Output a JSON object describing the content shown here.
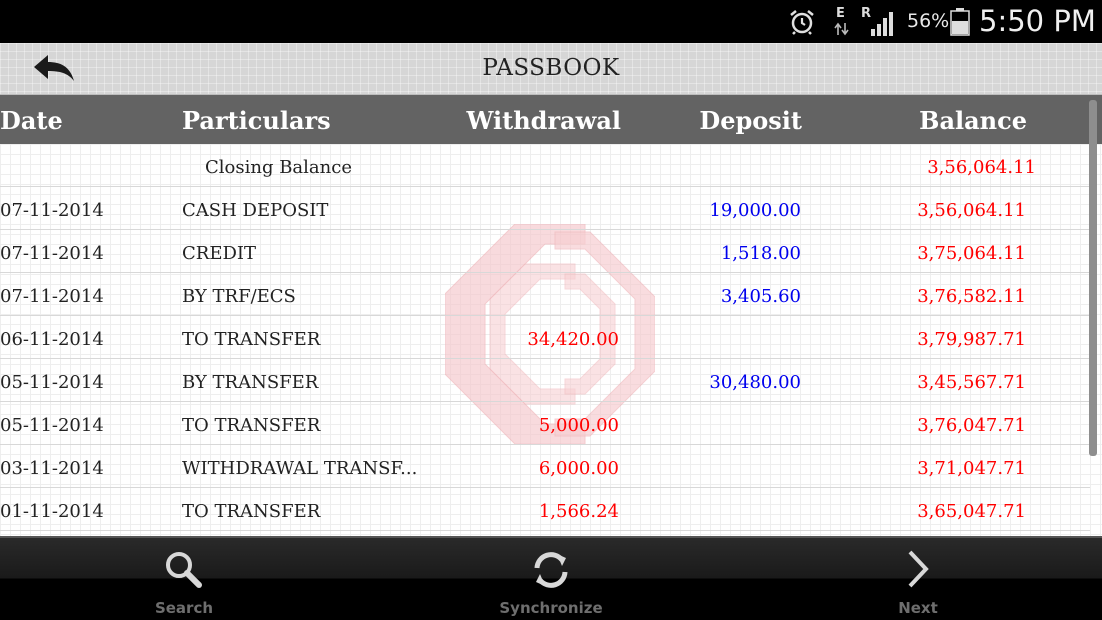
{
  "status_bar": {
    "network_letters": [
      "E",
      "R"
    ],
    "battery_percent": "56%",
    "time": "5:50 PM",
    "icons": [
      "alarm-icon",
      "data-arrows-icon",
      "signal-icon",
      "battery-icon"
    ]
  },
  "header": {
    "title": "PASSBOOK",
    "back_icon": "back-arrow-icon"
  },
  "table": {
    "columns": [
      "Date",
      "Particulars",
      "Withdrawal",
      "Deposit",
      "Balance"
    ],
    "closing": {
      "label": "Closing Balance",
      "balance": "3,56,064.11"
    },
    "rows": [
      {
        "date": "07-11-2014",
        "particulars": "CASH DEPOSIT",
        "withdrawal": "",
        "deposit": "19,000.00",
        "balance": "3,56,064.11"
      },
      {
        "date": "07-11-2014",
        "particulars": "CREDIT",
        "withdrawal": "",
        "deposit": "1,518.00",
        "balance": "3,75,064.11"
      },
      {
        "date": "07-11-2014",
        "particulars": "BY TRF/ECS",
        "withdrawal": "",
        "deposit": "3,405.60",
        "balance": "3,76,582.11"
      },
      {
        "date": "06-11-2014",
        "particulars": "TO TRANSFER",
        "withdrawal": "34,420.00",
        "deposit": "",
        "balance": "3,79,987.71"
      },
      {
        "date": "05-11-2014",
        "particulars": "BY TRANSFER",
        "withdrawal": "",
        "deposit": "30,480.00",
        "balance": "3,45,567.71"
      },
      {
        "date": "05-11-2014",
        "particulars": "TO TRANSFER",
        "withdrawal": "5,000.00",
        "deposit": "",
        "balance": "3,76,047.71"
      },
      {
        "date": "03-11-2014",
        "particulars": "WITHDRAWAL TRANSF...",
        "withdrawal": "6,000.00",
        "deposit": "",
        "balance": "3,71,047.71"
      },
      {
        "date": "01-11-2014",
        "particulars": "TO TRANSFER",
        "withdrawal": "1,566.24",
        "deposit": "",
        "balance": "3,65,047.71"
      }
    ]
  },
  "bottom_nav": [
    {
      "label": "Search",
      "icon": "search-icon"
    },
    {
      "label": "Synchronize",
      "icon": "sync-icon"
    },
    {
      "label": "Next",
      "icon": "chevron-right-icon"
    }
  ],
  "colors": {
    "withdrawal": "#ff0000",
    "deposit": "#0000ee",
    "balance": "#ff0000",
    "header_bg": "#636363",
    "watermark": "#f4c2c6"
  }
}
